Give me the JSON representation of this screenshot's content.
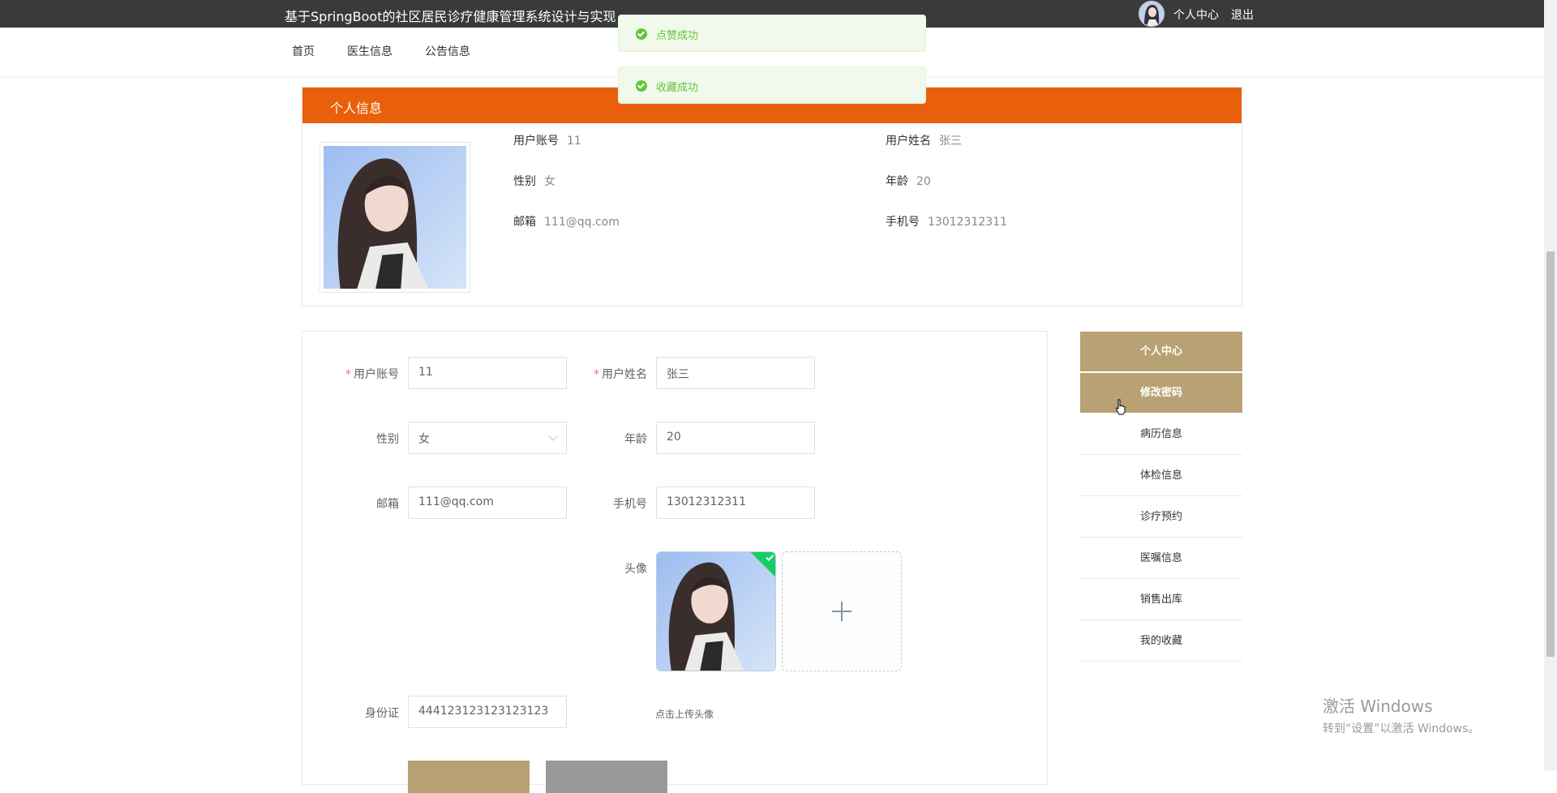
{
  "header": {
    "site_title": "基于SpringBoot的社区居民诊疗健康管理系统设计与实现",
    "user_center": "个人中心",
    "logout": "退出"
  },
  "nav": {
    "items": [
      "首页",
      "医生信息",
      "公告信息"
    ]
  },
  "toasts": [
    {
      "icon": "success-icon",
      "message": "点赞成功"
    },
    {
      "icon": "success-icon",
      "message": "收藏成功"
    }
  ],
  "profile": {
    "section_title": "个人信息",
    "fields": [
      {
        "label": "用户账号",
        "value": "11"
      },
      {
        "label": "用户姓名",
        "value": "张三"
      },
      {
        "label": "性别",
        "value": "女"
      },
      {
        "label": "年龄",
        "value": "20"
      },
      {
        "label": "邮箱",
        "value": "111@qq.com"
      },
      {
        "label": "手机号",
        "value": "13012312311"
      }
    ]
  },
  "form": {
    "account_label": "用户账号",
    "account_value": "11",
    "name_label": "用户姓名",
    "name_value": "张三",
    "gender_label": "性别",
    "gender_value": "女",
    "age_label": "年龄",
    "age_value": "20",
    "email_label": "邮箱",
    "email_value": "111@qq.com",
    "phone_label": "手机号",
    "phone_value": "13012312311",
    "avatar_label": "头像",
    "upload_hint": "点击上传头像",
    "idcard_label": "身份证",
    "idcard_value": "444123123123123123",
    "required_mark": "*"
  },
  "side_menu": {
    "items": [
      "个人中心",
      "修改密码",
      "病历信息",
      "体检信息",
      "诊疗预约",
      "医嘱信息",
      "销售出库",
      "我的收藏"
    ]
  },
  "watermark": {
    "line1": "激活 Windows",
    "line2": "转到“设置”以激活 Windows。"
  },
  "colors": {
    "header_bg": "#3a3a3a",
    "section_orange": "#ea5f0b",
    "menu_gold": "#b8a273",
    "success_green": "#67c23a"
  }
}
